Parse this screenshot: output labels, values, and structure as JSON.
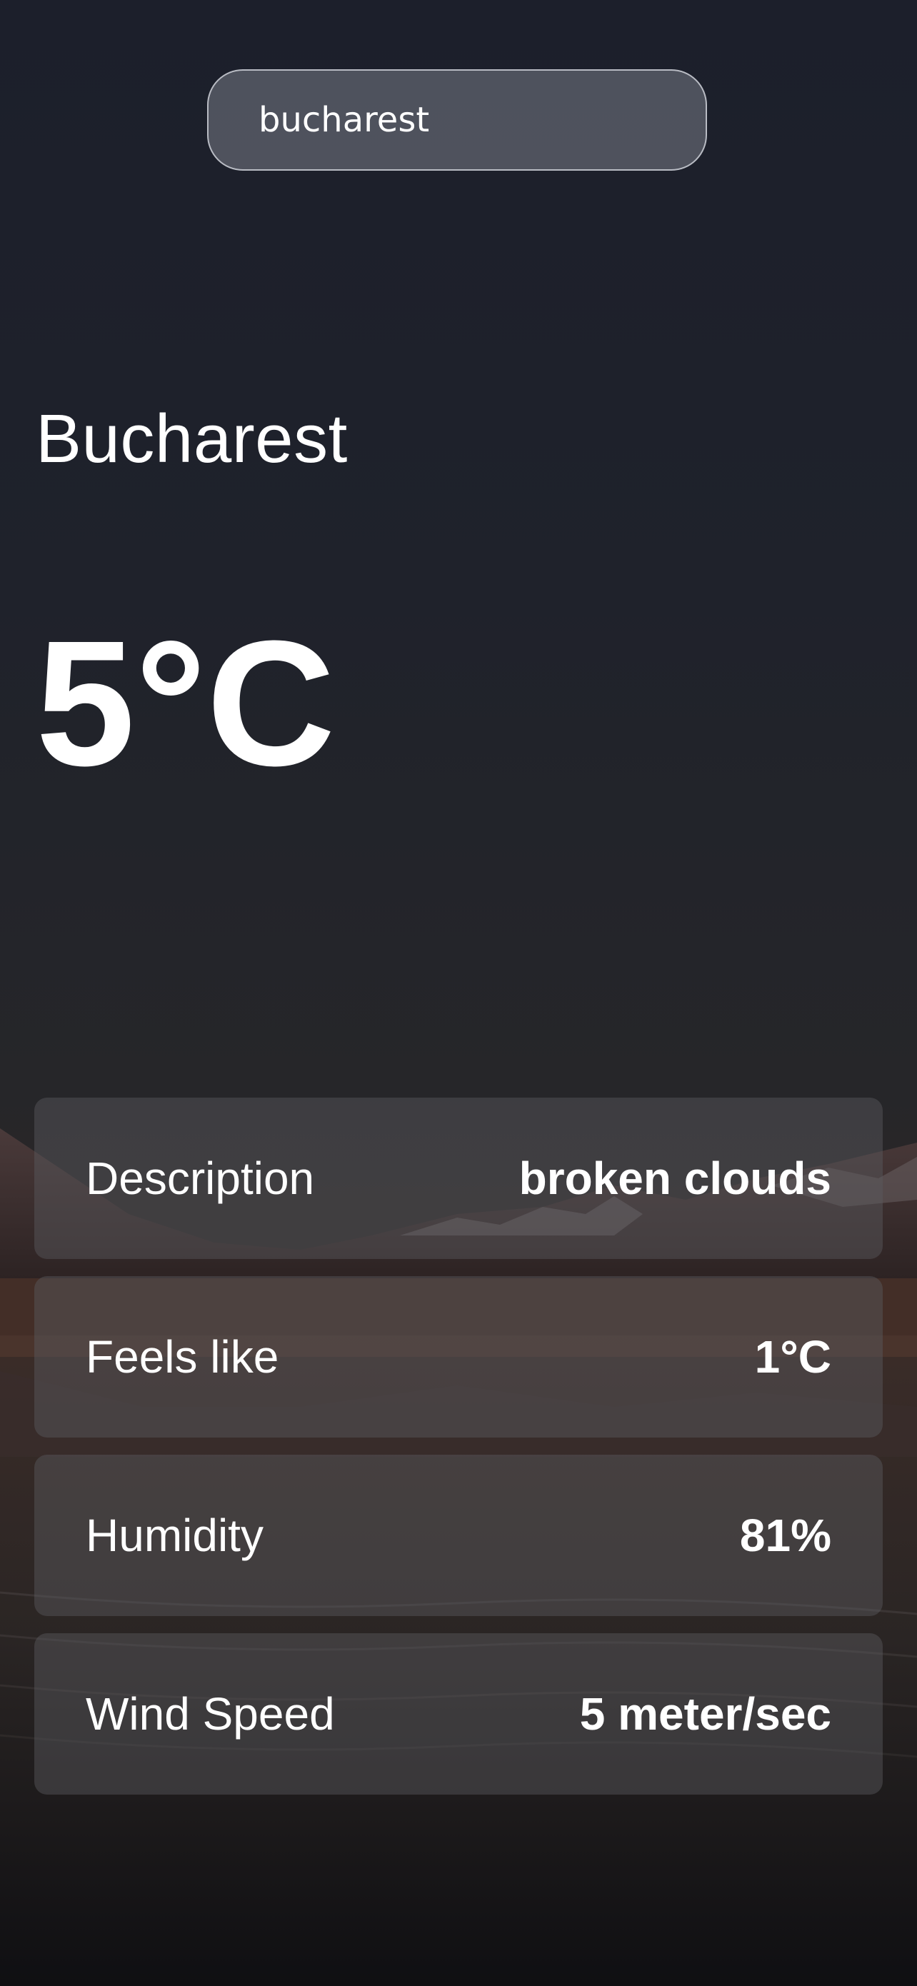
{
  "search": {
    "value": "bucharest",
    "placeholder": ""
  },
  "weather": {
    "city": "Bucharest",
    "temperature": "5°C"
  },
  "details": [
    {
      "label": "Description",
      "value": "broken clouds"
    },
    {
      "label": "Feels like",
      "value": "1°C"
    },
    {
      "label": "Humidity",
      "value": "81%"
    },
    {
      "label": "Wind Speed",
      "value": "5 meter/sec"
    }
  ],
  "colors": {
    "background": "#1c1f28",
    "text": "#ffffff",
    "search_border": "#b9bcc4"
  }
}
